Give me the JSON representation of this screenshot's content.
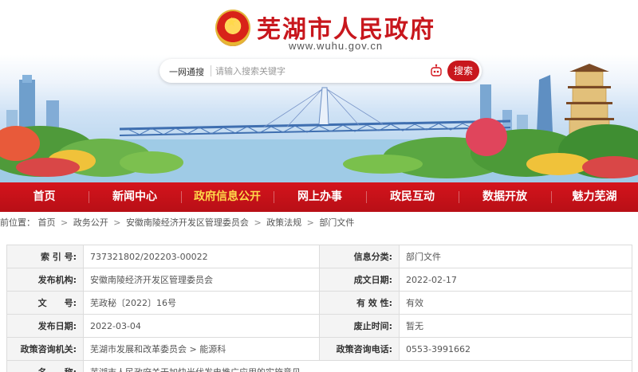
{
  "header": {
    "site_title": "芜湖市人民政府",
    "site_url": "www.wuhu.gov.cn"
  },
  "search": {
    "scope_label": "一网通搜",
    "placeholder": "请输入搜索关键字",
    "button_label": "搜索"
  },
  "nav": {
    "items": [
      {
        "label": "首页"
      },
      {
        "label": "新闻中心"
      },
      {
        "label": "政府信息公开"
      },
      {
        "label": "网上办事"
      },
      {
        "label": "政民互动"
      },
      {
        "label": "数据开放"
      },
      {
        "label": "魅力芜湖"
      }
    ],
    "active_index": 2
  },
  "breadcrumb": {
    "prefix": "前位置：",
    "items": [
      "首页",
      "政务公开",
      "安徽南陵经济开发区管理委员会",
      "政策法规",
      "部门文件"
    ],
    "separator": ">"
  },
  "info": {
    "rows": [
      {
        "k1": "索 引 号:",
        "v1": "737321802/202203-00022",
        "k2": "信息分类:",
        "v2": "部门文件"
      },
      {
        "k1": "发布机构:",
        "v1": "安徽南陵经济开发区管理委员会",
        "k2": "成文日期:",
        "v2": "2022-02-17"
      },
      {
        "k1": "文　　号:",
        "v1": "芜政秘〔2022〕16号",
        "k2": "有 效 性:",
        "v2": "有效"
      },
      {
        "k1": "发布日期:",
        "v1": "2022-03-04",
        "k2": "废止时间:",
        "v2": "暂无"
      },
      {
        "k1": "政策咨询机关:",
        "v1": "芜湖市发展和改革委员会 > 能源科",
        "k2": "政策咨询电话:",
        "v2": "0553-3991662"
      },
      {
        "k1": "名　　称:",
        "v1": "芜湖市人民政府关于加快光伏发电推广应用的实施意见",
        "k2": "",
        "v2": ""
      }
    ]
  },
  "colors": {
    "brand_red": "#c8171d",
    "nav_active": "#ffd84a"
  }
}
